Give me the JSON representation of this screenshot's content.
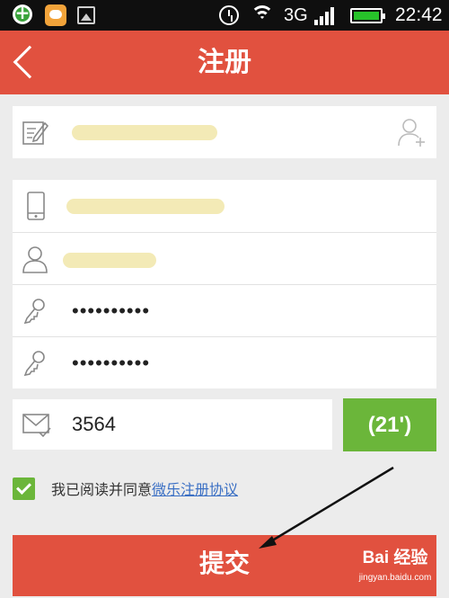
{
  "status_bar": {
    "network": "3G",
    "time": "22:42",
    "icons": [
      "clover-app-icon",
      "chat-app-icon",
      "image-icon",
      "alarm-icon",
      "wifi-icon",
      "signal-icon",
      "battery-icon"
    ]
  },
  "header": {
    "title": "注册",
    "back_icon": "chevron-left-icon"
  },
  "form": {
    "invite_phone": "",
    "phone": "",
    "nickname": "",
    "password": "••••••••••",
    "password_confirm": "••••••••••",
    "captcha": "3564",
    "countdown": "(21')"
  },
  "agreement": {
    "checked": true,
    "text": "我已阅读并同意",
    "link": "微乐注册协议"
  },
  "submit_label": "提交",
  "watermark": {
    "logo": "Bai 经验",
    "url": "jingyan.baidu.com"
  },
  "colors": {
    "header_bg": "#e1513f",
    "accent_green": "#6bb63a",
    "link": "#3a6fc4",
    "redaction": "#f3eab6"
  }
}
